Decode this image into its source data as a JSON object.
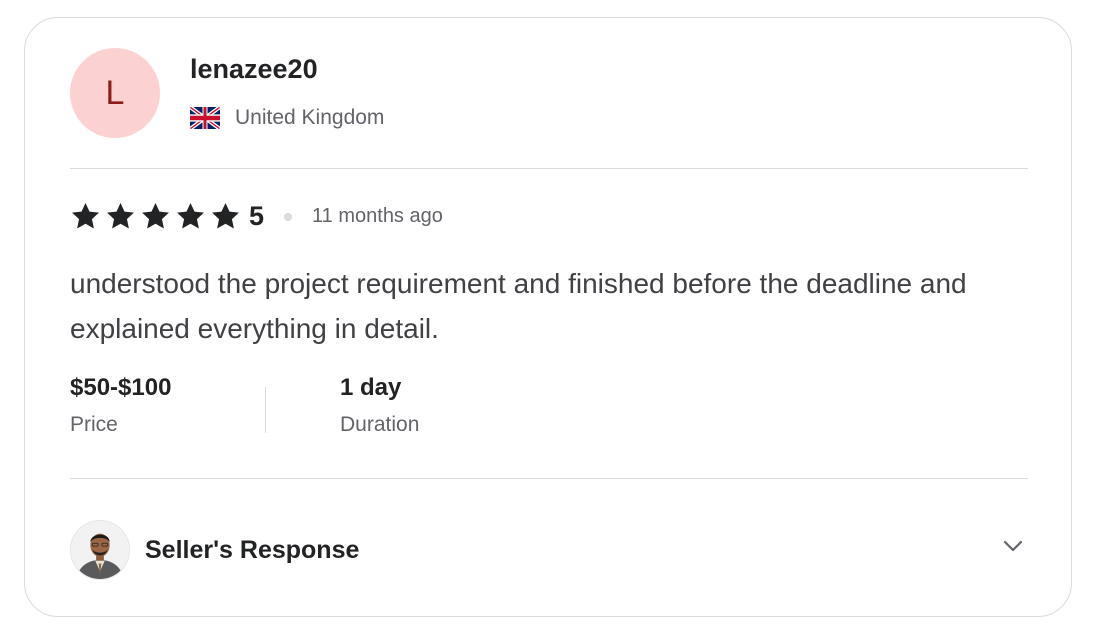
{
  "reviewer": {
    "avatar_letter": "L",
    "username": "lenazee20",
    "country": "United Kingdom",
    "flag_icon": "uk-flag-icon"
  },
  "rating": {
    "stars": 5,
    "value": "5",
    "time_ago": "11 months ago"
  },
  "review": {
    "text": "understood the project requirement and finished before the deadline and explained everything in detail."
  },
  "details": {
    "price_value": "$50-$100",
    "price_label": "Price",
    "duration_value": "1 day",
    "duration_label": "Duration"
  },
  "seller_response": {
    "label": "Seller's Response",
    "expand_icon": "chevron-down-icon"
  },
  "colors": {
    "avatar_bg": "#fcd1d1",
    "avatar_letter": "#8f1b1b",
    "text_primary": "#222325",
    "text_secondary": "#62646a",
    "divider": "#dadbdd"
  }
}
